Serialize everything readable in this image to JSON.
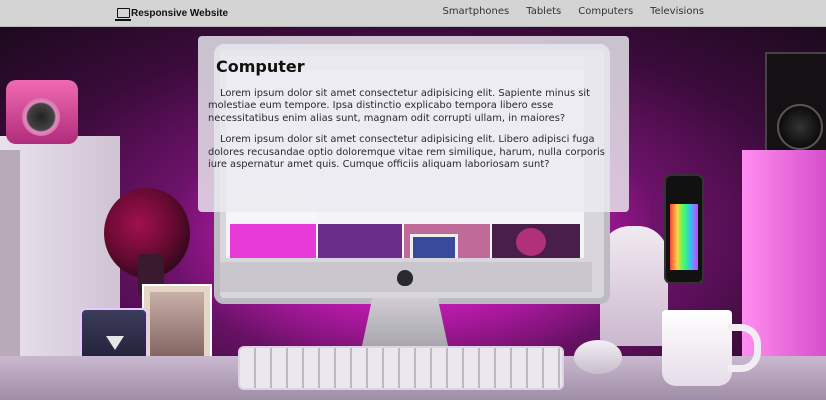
{
  "navbar": {
    "brand": "Responsive Website",
    "brand_icon": "laptop-icon",
    "links": [
      "Smartphones",
      "Tablets",
      "Computers",
      "Televisions"
    ]
  },
  "card": {
    "title": "Computer",
    "paragraphs": [
      "Lorem ipsum dolor sit amet consectetur adipisicing elit. Sapiente minus sit molestiae eum tempore. Ipsa distinctio explicabo tempora libero esse necessitatibus enim alias sunt, magnam odit corrupti ullam, in maiores?",
      "Lorem ipsum dolor sit amet consectetur adipisicing elit. Libero adipisci fuga dolores recusandae optio doloremque vitae rem similique, harum, nulla corporis iure aspernatur amet quis. Cumque officiis aliquam laboriosam sunt?"
    ]
  },
  "theme": {
    "navbar_bg": "#d4d4d4",
    "accent_glow": "#ff3cf0",
    "card_bg": "#eceaf0"
  }
}
